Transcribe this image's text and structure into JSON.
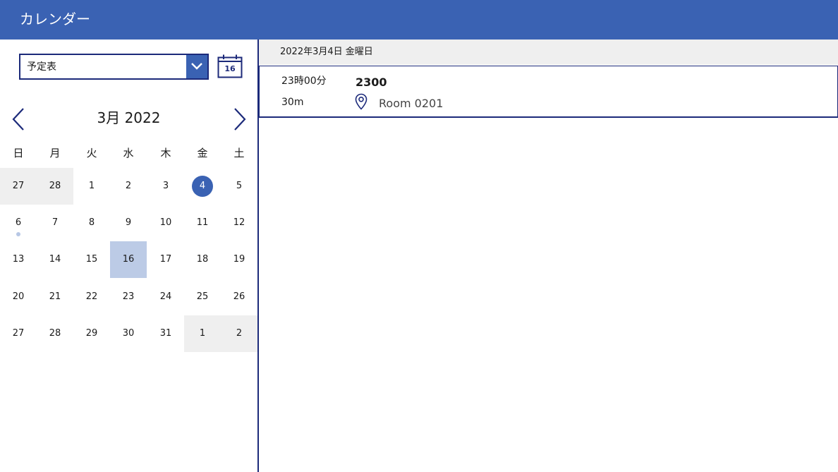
{
  "app": {
    "title": "カレンダー"
  },
  "calendar_select": {
    "value": "予定表",
    "icon": "chevron-down-icon"
  },
  "today_button": {
    "icon": "calendar-icon",
    "number": "16"
  },
  "month_nav": {
    "title": "3月 2022",
    "prev_icon": "chevron-left-icon",
    "next_icon": "chevron-right-icon"
  },
  "weekdays": [
    "日",
    "月",
    "火",
    "水",
    "木",
    "金",
    "土"
  ],
  "weeks": [
    [
      {
        "label": "27",
        "state": "outside"
      },
      {
        "label": "28",
        "state": "outside"
      },
      {
        "label": "1"
      },
      {
        "label": "2"
      },
      {
        "label": "3"
      },
      {
        "label": "4",
        "state": "selected"
      },
      {
        "label": "5"
      }
    ],
    [
      {
        "label": "6",
        "has_event": true
      },
      {
        "label": "7"
      },
      {
        "label": "8"
      },
      {
        "label": "9"
      },
      {
        "label": "10"
      },
      {
        "label": "11"
      },
      {
        "label": "12"
      }
    ],
    [
      {
        "label": "13"
      },
      {
        "label": "14"
      },
      {
        "label": "15"
      },
      {
        "label": "16",
        "state": "today"
      },
      {
        "label": "17"
      },
      {
        "label": "18"
      },
      {
        "label": "19"
      }
    ],
    [
      {
        "label": "20"
      },
      {
        "label": "21"
      },
      {
        "label": "22"
      },
      {
        "label": "23"
      },
      {
        "label": "24"
      },
      {
        "label": "25"
      },
      {
        "label": "26"
      }
    ],
    [
      {
        "label": "27"
      },
      {
        "label": "28"
      },
      {
        "label": "29"
      },
      {
        "label": "30"
      },
      {
        "label": "31"
      },
      {
        "label": "1",
        "state": "outside"
      },
      {
        "label": "2",
        "state": "outside"
      }
    ]
  ],
  "agenda": {
    "date_heading": "2022年3月4日 金曜日",
    "events": [
      {
        "time": "23時00分",
        "duration": "30m",
        "title": "2300",
        "location": "Room 0201",
        "location_icon": "map-pin-icon"
      }
    ]
  },
  "colors": {
    "header": "#3a62b3",
    "accent_dark": "#1c2a7a",
    "outside_day": "#efefef",
    "today_highlight": "#bccbe6",
    "event_dot": "#b7c7e5"
  }
}
